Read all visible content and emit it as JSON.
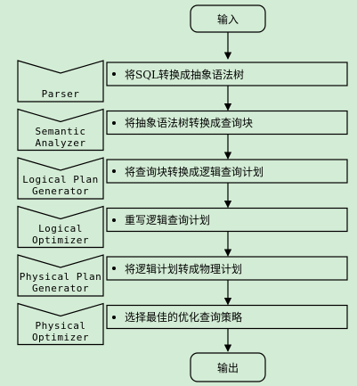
{
  "start": "输入",
  "end": "输出",
  "stages": [
    {
      "label": [
        "Parser"
      ],
      "desc": "将SQL转换成抽象语法树"
    },
    {
      "label": [
        "Semantic",
        "Analyzer"
      ],
      "desc": "将抽象语法树转换成查询块"
    },
    {
      "label": [
        "Logical Plan",
        "Generator"
      ],
      "desc": "将查询块转换成逻辑查询计划"
    },
    {
      "label": [
        "Logical",
        "Optimizer"
      ],
      "desc": "重写逻辑查询计划"
    },
    {
      "label": [
        "Physical Plan",
        "Generator"
      ],
      "desc": "将逻辑计划转成物理计划"
    },
    {
      "label": [
        "Physical",
        "Optimizer"
      ],
      "desc": "选择最佳的优化查询策略"
    }
  ],
  "colors": {
    "background": "#d3ecd5",
    "stroke": "#000000"
  }
}
